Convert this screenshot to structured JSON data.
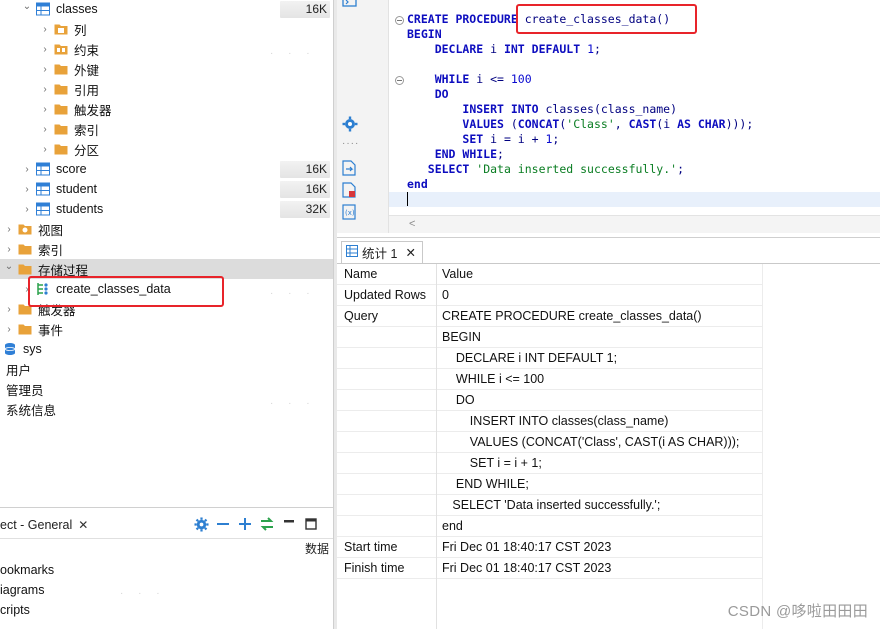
{
  "navigator": {
    "tree": [
      {
        "label": "classes",
        "size": "16K",
        "kind": "table",
        "indent": 1,
        "expanded": true
      },
      {
        "label": "列",
        "kind": "folder-columns",
        "indent": 2
      },
      {
        "label": "约束",
        "kind": "folder-constraint",
        "indent": 2
      },
      {
        "label": "外键",
        "kind": "folder",
        "indent": 2
      },
      {
        "label": "引用",
        "kind": "folder",
        "indent": 2
      },
      {
        "label": "触发器",
        "kind": "folder",
        "indent": 2
      },
      {
        "label": "索引",
        "kind": "folder",
        "indent": 2
      },
      {
        "label": "分区",
        "kind": "folder",
        "indent": 2
      },
      {
        "label": "score",
        "size": "16K",
        "kind": "table",
        "indent": 1
      },
      {
        "label": "student",
        "size": "16K",
        "kind": "table",
        "indent": 1
      },
      {
        "label": "students",
        "size": "32K",
        "kind": "table",
        "indent": 1
      },
      {
        "label": "视图",
        "kind": "folder-view",
        "indent": 0
      },
      {
        "label": "索引",
        "kind": "folder",
        "indent": 0
      },
      {
        "label": "存储过程",
        "kind": "folder",
        "indent": 0,
        "expanded": true,
        "selected": true
      },
      {
        "label": "create_classes_data",
        "kind": "procedure",
        "indent": 1
      },
      {
        "label": "触发器",
        "kind": "folder",
        "indent": 0
      },
      {
        "label": "事件",
        "kind": "folder",
        "indent": 0
      },
      {
        "label": "sys",
        "kind": "database",
        "indent": -1
      },
      {
        "label": "用户",
        "kind": "none",
        "indent": -2
      },
      {
        "label": "管理员",
        "kind": "none",
        "indent": -2
      },
      {
        "label": "系统信息",
        "kind": "none",
        "indent": -2
      }
    ]
  },
  "project_panel": {
    "tab_label": "ect - General",
    "column_header": "数据",
    "items": [
      "ookmarks",
      "iagrams",
      "cripts"
    ]
  },
  "editor": {
    "highlight_text": "create_classes_data()",
    "lines": [
      "CREATE PROCEDURE create_classes_data()",
      "BEGIN",
      "    DECLARE i INT DEFAULT 1;",
      "",
      "    WHILE i <= 100",
      "    DO",
      "        INSERT INTO classes(class_name)",
      "        VALUES (CONCAT('Class', CAST(i AS CHAR)));",
      "        SET i = i + 1;",
      "    END WHILE;",
      "   SELECT 'Data inserted successfully.';",
      "end",
      ""
    ]
  },
  "results": {
    "tab_label": "统计 1",
    "header": {
      "name": "Name",
      "value": "Value"
    },
    "rows": [
      {
        "name": "Updated Rows",
        "value": "0"
      },
      {
        "name": "Query",
        "value": "CREATE PROCEDURE create_classes_data()"
      },
      {
        "name": "",
        "value": "BEGIN"
      },
      {
        "name": "",
        "value": "    DECLARE i INT DEFAULT 1;"
      },
      {
        "name": "",
        "value": "    WHILE i <= 100"
      },
      {
        "name": "",
        "value": "    DO"
      },
      {
        "name": "",
        "value": "        INSERT INTO classes(class_name)"
      },
      {
        "name": "",
        "value": "        VALUES (CONCAT('Class', CAST(i AS CHAR)));"
      },
      {
        "name": "",
        "value": "        SET i = i + 1;"
      },
      {
        "name": "",
        "value": "    END WHILE;"
      },
      {
        "name": "",
        "value": "   SELECT 'Data inserted successfully.';"
      },
      {
        "name": "",
        "value": "end"
      },
      {
        "name": "Start time",
        "value": "Fri Dec 01 18:40:17 CST 2023"
      },
      {
        "name": "Finish time",
        "value": "Fri Dec 01 18:40:17 CST 2023"
      }
    ]
  },
  "watermark": "CSDN @哆啦田田田",
  "colors": {
    "highlight_border": "#e8242a",
    "keyword": "#0d0dbf",
    "string": "#0a7d22",
    "folder": "#e8a23a",
    "table_icon": "#2f7fd6",
    "selected_row": "#dcdcdc"
  }
}
